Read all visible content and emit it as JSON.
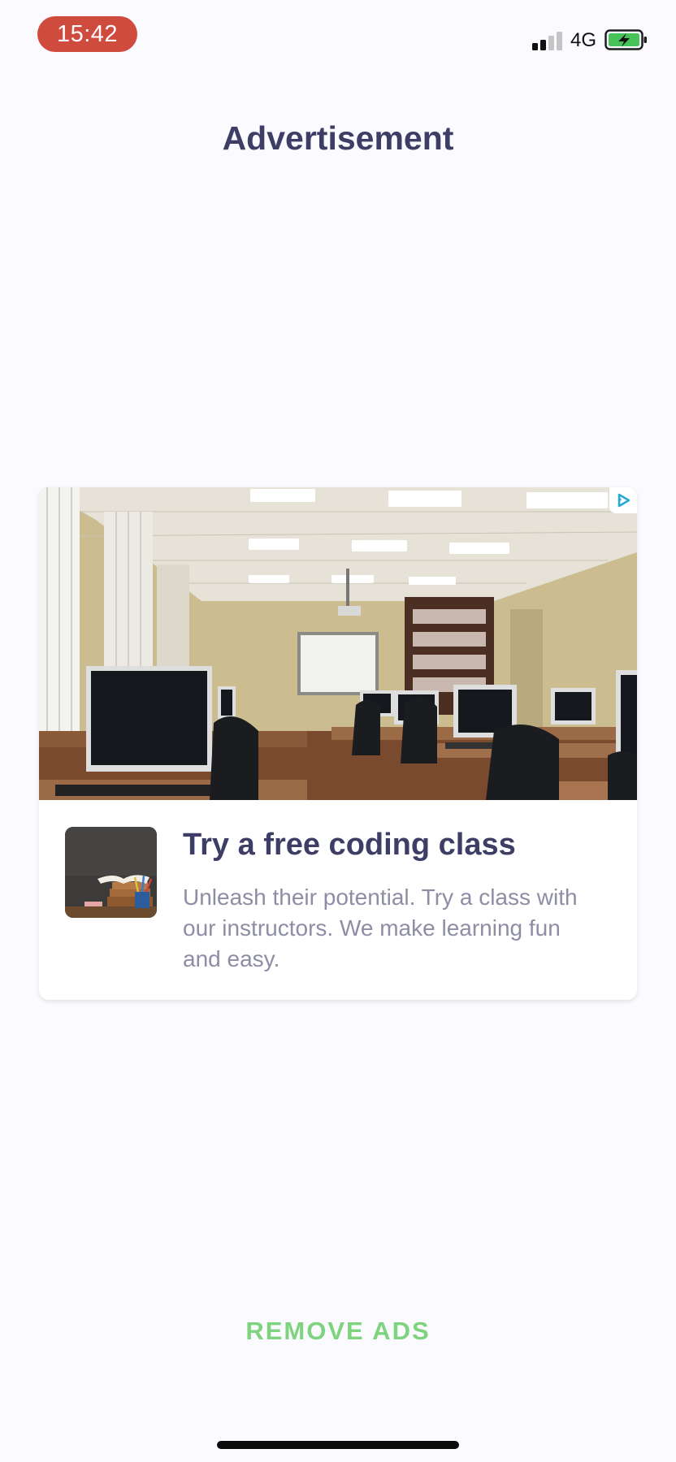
{
  "status_bar": {
    "time": "15:42",
    "network": "4G",
    "battery": "charging"
  },
  "header": {
    "title": "Advertisement"
  },
  "ad": {
    "image": "classroom-with-computers",
    "thumbnail": "books-and-pencils",
    "headline": "Try a free coding class",
    "body": "Unleash their potential. Try a class with our instructors. We make learning fun and easy."
  },
  "footer": {
    "remove_ads_label": "REMOVE ADS"
  },
  "colors": {
    "time_pill": "#cf4b3e",
    "title_text": "#3d3d66",
    "body_text": "#8d8da6",
    "accent_green": "#7ed37f",
    "battery_green": "#48c35a"
  }
}
